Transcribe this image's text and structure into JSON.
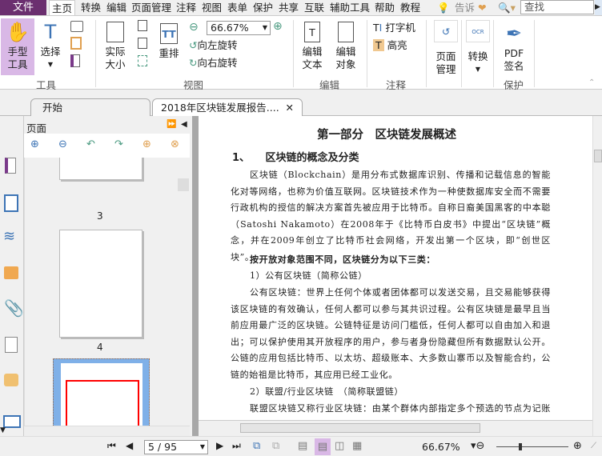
{
  "menu": {
    "file": "文件",
    "items": [
      "主页",
      "转换",
      "编辑",
      "页面管理",
      "注释",
      "视图",
      "表单",
      "保护",
      "共享",
      "互联",
      "辅助工具",
      "帮助",
      "教程"
    ],
    "tell": "告诉",
    "search_placeholder": "查找"
  },
  "ribbon": {
    "hand_tool": "手型\n工具",
    "select": "选择",
    "tools_group": "工具",
    "actual_size": "实际\n大小",
    "reflow": "重排",
    "zoom_value": "66.67%",
    "rotate_left": "向左旋转",
    "rotate_right": "向右旋转",
    "view_group": "视图",
    "edit_text": "编辑\n文本",
    "edit_object": "编辑\n对象",
    "edit_group": "编辑",
    "typewriter": "打字机",
    "highlight": "高亮",
    "comment_group": "注释",
    "page_manage": "页面\n管理",
    "convert": "转换",
    "pdf_sign": "PDF\n签名",
    "protect_group": "保护"
  },
  "tabs": [
    {
      "label": "开始"
    },
    {
      "label": "2018年区块链发展报告...."
    }
  ],
  "panel": {
    "title": "页面",
    "thumbs": [
      {
        "num": "3"
      },
      {
        "num": "4"
      }
    ]
  },
  "document": {
    "title": "第一部分　区块链发展概述",
    "heading": "1、　　区块链的概念及分类",
    "para1": "区块链（Blockchain）是用分布式数据库识别、传播和记载信息的智能化对等网络，也称为价值互联网。区块链技术作为一种使数据库安全而不需要行政机构的授信的解决方案首先被应用于比特币。自称日裔美国黑客的中本聪（Satoshi Nakamoto）在2008年于《比特币白皮书》中提出“区块链”概念，并在2009年创立了比特币社会网络，开发出第一个区块，即“创世区块”。",
    "bold_line": "按开放对象范围不同，区块链分为以下三类：",
    "sub1": "1）公有区块链（简称公链）",
    "para2": "公有区块链：世界上任何个体或者团体都可以发送交易，且交易能够获得该区块链的有效确认，任何人都可以参与其共识过程。公有区块链是最早且当前应用最广泛的区块链。公链特征是访问门槛低，任何人都可以自由加入和退出；可以保护使用其开放程序的用户，参与者身份隐藏但所有数据默认公开。公链的应用包括比特币、以太坊、超级账本、大多数山寨币以及智能合约，公链的始祖是比特币，其应用已经工业化。",
    "sub2": "2）联盟/行业区块链　（简称联盟链）",
    "para3": "联盟区块链又称行业区块链：由某个群体内部指定多个预选的节点为记账人，每个块的生成由所有的预选节点共同决定（预选节点参与共识过程），其他接入节点"
  },
  "status": {
    "page": "5 / 95",
    "zoom": "66.67%"
  },
  "colors": {
    "brand": "#6b2f6f",
    "active_tool": "#d9b8e6"
  }
}
